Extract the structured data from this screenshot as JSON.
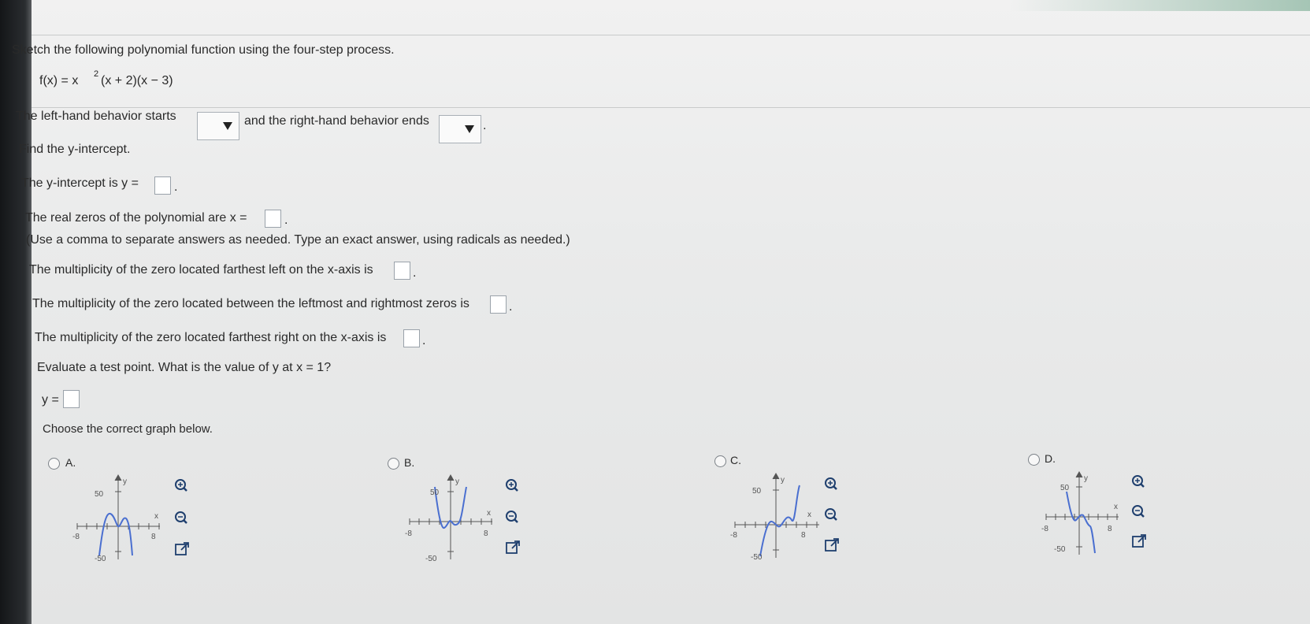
{
  "question": {
    "prompt": "Sketch the following polynomial function using the four-step process.",
    "func_main": "f(x) = x",
    "func_exp": "2",
    "func_rest": "(x + 2)(x − 3)"
  },
  "behavior": {
    "left_label": "The left-hand behavior starts",
    "right_label": "and the right-hand behavior ends",
    "end": "."
  },
  "y_intercept": {
    "heading": "Find the y-intercept.",
    "label": "The y-intercept is y =",
    "end": "."
  },
  "zeros": {
    "label": "The real zeros of the polynomial are x =",
    "end": ".",
    "hint": "(Use a comma to separate answers as needed. Type an exact answer, using radicals as needed.)"
  },
  "multiplicity": {
    "left": "The multiplicity of the zero located farthest left on the x-axis is",
    "middle": "The multiplicity of the zero located between the leftmost and rightmost zeros is",
    "right": "The multiplicity of the zero located farthest right on the x-axis is",
    "end": "."
  },
  "test_point": {
    "label": "Evaluate a test point. What is the value of y at x = 1?",
    "answer_label": "y ="
  },
  "choose": "Choose the correct graph below.",
  "options": [
    {
      "letter": "A."
    },
    {
      "letter": "B."
    },
    {
      "letter": "C."
    },
    {
      "letter": "D."
    }
  ],
  "graph_labels": {
    "y_axis": "y",
    "x_axis": "x",
    "ymax": "50",
    "ymin": "-50",
    "xmin": "-8",
    "xmax": "8"
  },
  "icons": {
    "zoom_in": "zoom-in-icon",
    "zoom_out": "zoom-out-icon",
    "popout": "popout-icon"
  }
}
